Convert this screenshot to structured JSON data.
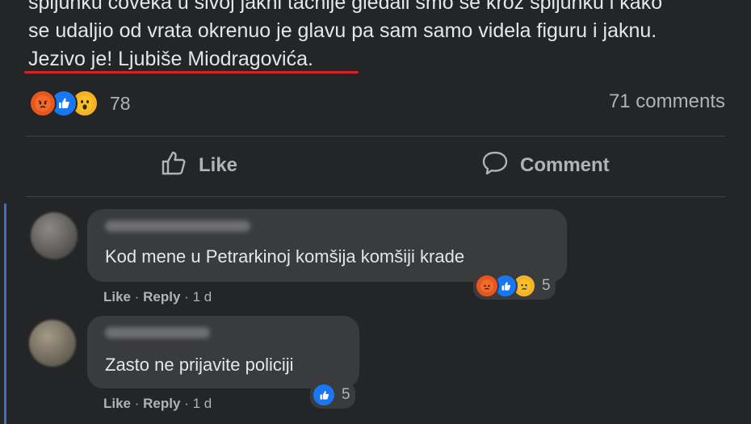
{
  "post": {
    "text_lines": [
      "špijunku čoveka u sivoj jakni tačnije gledali smo se kroz špijunku i kako",
      "se udaljio od vrata okrenuo je glavu pa sam samo videla figuru i jaknu.",
      "Jezivo je! Ljubiše Miodragovića."
    ],
    "reaction_count": "78",
    "comments_count": "71 comments",
    "like_label": "Like",
    "comment_label": "Comment"
  },
  "comments": [
    {
      "text": "Kod mene u Petrarkinoj komšija komšiji krade",
      "like_label": "Like",
      "reply_label": "Reply",
      "age": "1 d",
      "reaction_count": "5"
    },
    {
      "text": "Zasto ne prijavite policiji",
      "like_label": "Like",
      "reply_label": "Reply",
      "age": "1 d",
      "reaction_count": "5"
    }
  ],
  "colors": {
    "background": "#242526",
    "bubble": "#3a3b3c",
    "underline": "#d8222a",
    "like_blue": "#1877f2",
    "angry_orange": "#e8561e",
    "wow_yellow": "#f7b125"
  },
  "icons": {
    "reactions": [
      "angry-icon",
      "like-icon",
      "wow-icon"
    ],
    "like_action": "thumbs-up-icon",
    "comment_action": "speech-bubble-icon"
  }
}
